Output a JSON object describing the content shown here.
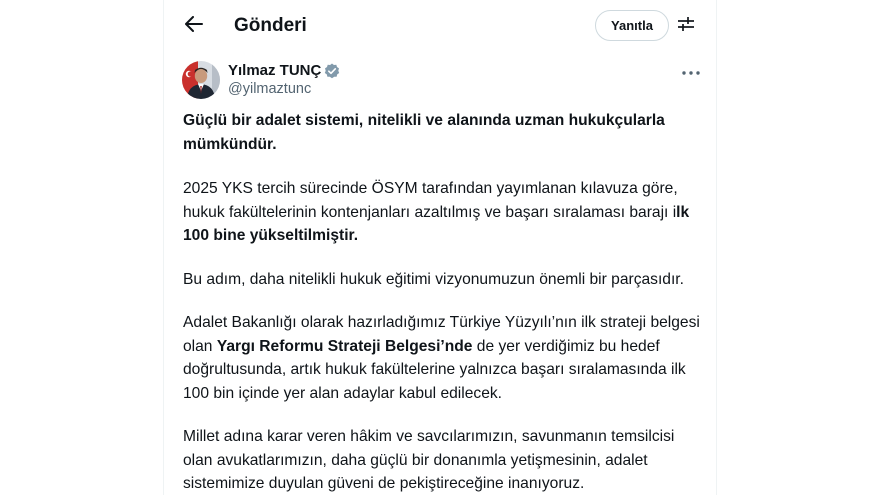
{
  "header": {
    "back_icon": "arrow-left-icon",
    "title": "Gönderi",
    "reply_label": "Yanıtla",
    "filter_icon": "sliders-icon"
  },
  "author": {
    "name": "Yılmaz TUNÇ",
    "handle": "@yilmaztunc",
    "verified_icon": "verified-badge-icon",
    "verified_color": "#829aab",
    "more_icon": "more-dots-icon"
  },
  "tweet": {
    "p1": "Güçlü bir adalet sistemi, nitelikli ve alanında uzman hukukçularla mümkündür.",
    "p2_a": "2025 YKS tercih sürecinde ÖSYM tarafından yayımlanan kılavuza göre, hukuk fakültelerinin kontenjanları azaltılmış ve başarı sıralaması barajı i",
    "p2_b": "lk 100 bine yükseltilmiştir.",
    "p3": "Bu adım, daha nitelikli hukuk eğitimi vizyonumuzun önemli bir parçasıdır.",
    "p4_a": "Adalet Bakanlığı olarak hazırladığımız Türkiye Yüzyılı’nın ilk strateji belgesi olan ",
    "p4_b": "Yargı Reformu Strateji Belgesi’nde",
    "p4_c": " de yer verdiğimiz bu hedef doğrultusunda, artık hukuk fakültelerine yalnızca başarı sıralamasında ilk 100 bin içinde yer alan adaylar kabul edilecek.",
    "p5": "Millet adına karar veren hâkim ve savcılarımızın, savunmanın temsilcisi olan avukatlarımızın, daha güçlü bir donanımla yetişmesinin, adalet sistemimize duyulan güveni de pekiştireceğine inanıyoruz."
  }
}
